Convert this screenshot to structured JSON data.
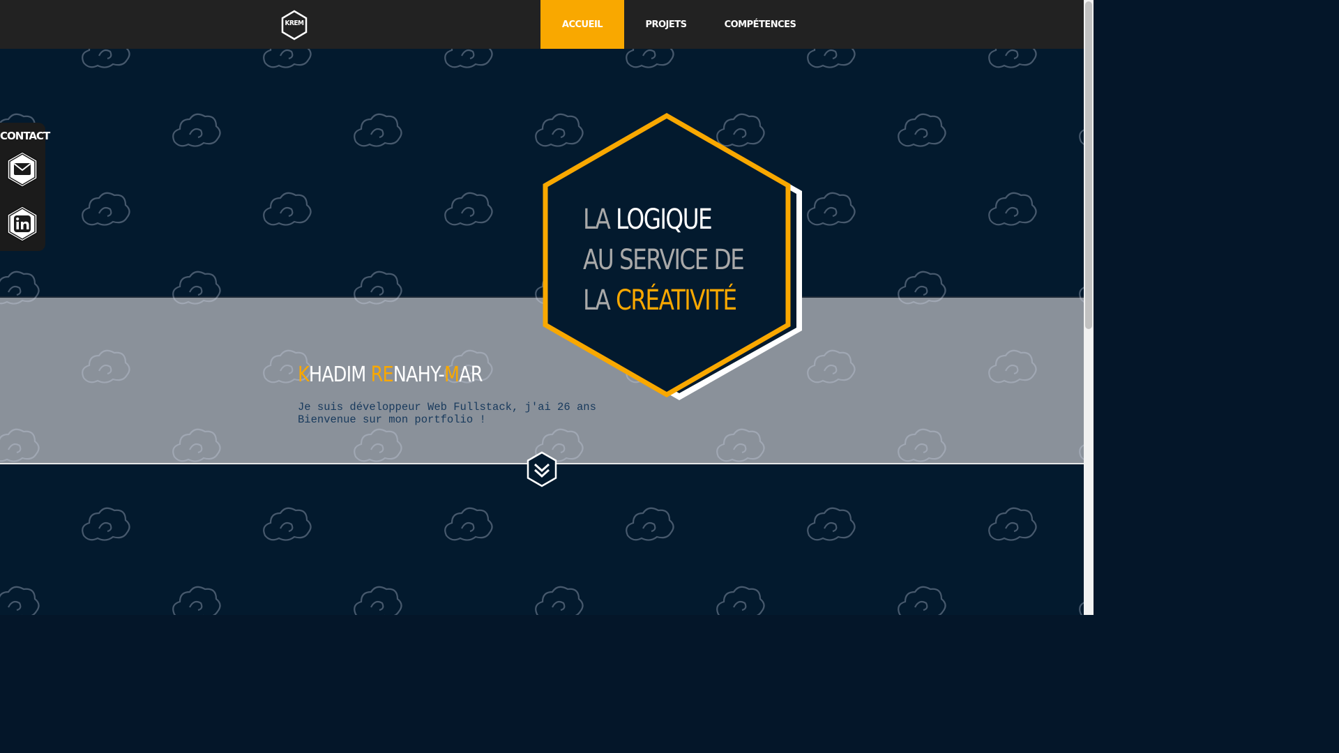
{
  "navbar": {
    "logo_text": "KREM",
    "items": [
      {
        "label": "ACCUEIL",
        "active": true
      },
      {
        "label": "PROJETS",
        "active": false
      },
      {
        "label": "COMPÉTENCES",
        "active": false
      }
    ]
  },
  "contact": {
    "title": "CONTACT",
    "icons": [
      "envelope-icon",
      "linkedin-icon"
    ]
  },
  "hero": {
    "line1_a": "LA ",
    "line1_b": "LOGIQUE",
    "line2": "AU SERVICE DE",
    "line3_a": "LA ",
    "line3_b": "CRÉATIVITÉ"
  },
  "profile": {
    "name_k": "K",
    "name_hadim": "HADIM ",
    "name_re": "RE",
    "name_nahy": "NAHY-",
    "name_m": "M",
    "name_ar": "AR",
    "intro_line1": "Je suis développeur Web Fullstack, j'ai 26 ans",
    "intro_line2": "Bienvenue sur mon portfolio !"
  },
  "scroll": {
    "icon": "double-chevron-down-icon"
  },
  "colors": {
    "accent": "#f9a800",
    "navbar": "#222222",
    "dark_bg": "#031a2e",
    "band_bg": "#8a919a"
  }
}
